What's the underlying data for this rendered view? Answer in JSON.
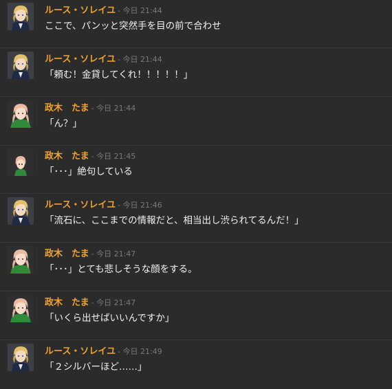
{
  "messages": [
    {
      "author": "ルース・ソレイユ",
      "timestamp": "- 今日 21:44",
      "text": "ここで、パンッと突然手を目の前で合わせ",
      "avatar": "ruth"
    },
    {
      "author": "ルース・ソレイユ",
      "timestamp": "- 今日 21:44",
      "text": "「頼む！金貸してくれ！！！！！」",
      "avatar": "ruth"
    },
    {
      "author": "政木　たま",
      "timestamp": "- 今日 21:44",
      "text": "「ん？」",
      "avatar": "tama"
    },
    {
      "author": "政木　たま",
      "timestamp": "- 今日 21:45",
      "text": "「･･･」絶句している",
      "avatar": "tama-small"
    },
    {
      "author": "ルース・ソレイユ",
      "timestamp": "- 今日 21:46",
      "text": "「流石に、ここまでの情報だと、相当出し渋られてるんだ！」",
      "avatar": "ruth"
    },
    {
      "author": "政木　たま",
      "timestamp": "- 今日 21:47",
      "text": "「･･･」とても悲しそうな顔をする。",
      "avatar": "tama"
    },
    {
      "author": "政木　たま",
      "timestamp": "- 今日 21:47",
      "text": "「いくら出せばいいんですか」",
      "avatar": "tama"
    },
    {
      "author": "ルース・ソレイユ",
      "timestamp": "- 今日 21:49",
      "text": "「２シルバーほど……」",
      "avatar": "ruth"
    }
  ],
  "colors": {
    "background": "#2b2b2b",
    "author": "#f0a32e",
    "timestamp": "#7a7a7a",
    "text": "#f1f1f1",
    "divider": "#3a3a3a"
  }
}
